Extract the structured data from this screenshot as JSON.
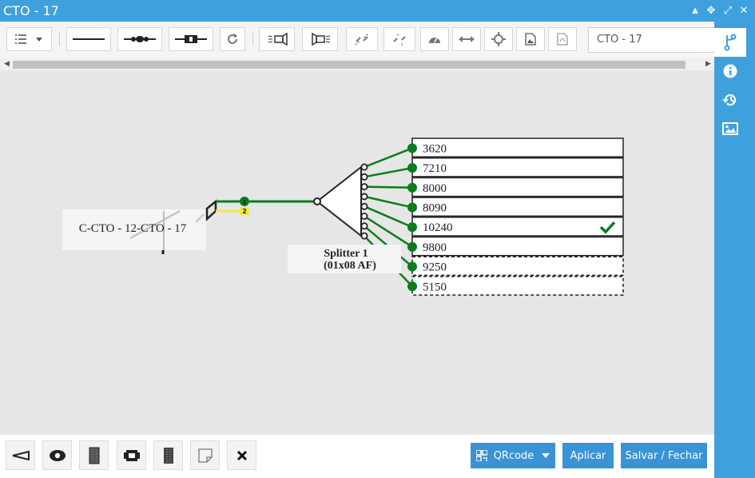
{
  "window": {
    "title": "CTO - 17"
  },
  "search": {
    "value": "CTO - 17"
  },
  "diagram": {
    "cable_label": "C-CTO - 12-CTO - 17",
    "cable_fibers": [
      "1",
      "2"
    ],
    "splitter_name": "Splitter 1",
    "splitter_type": "(01x08 AF)",
    "outputs": [
      "3620",
      "7210",
      "8000",
      "8090",
      "10240",
      "9800",
      "9250",
      "5150"
    ],
    "checked_output": "10240"
  },
  "footer": {
    "qrcode_label": "QRcode",
    "apply_label": "Aplicar",
    "save_close_label": "Salvar / Fechar"
  },
  "colors": {
    "accent": "#3ea0dd",
    "fiber": "#0a7d1a",
    "button": "#3a93d4"
  }
}
